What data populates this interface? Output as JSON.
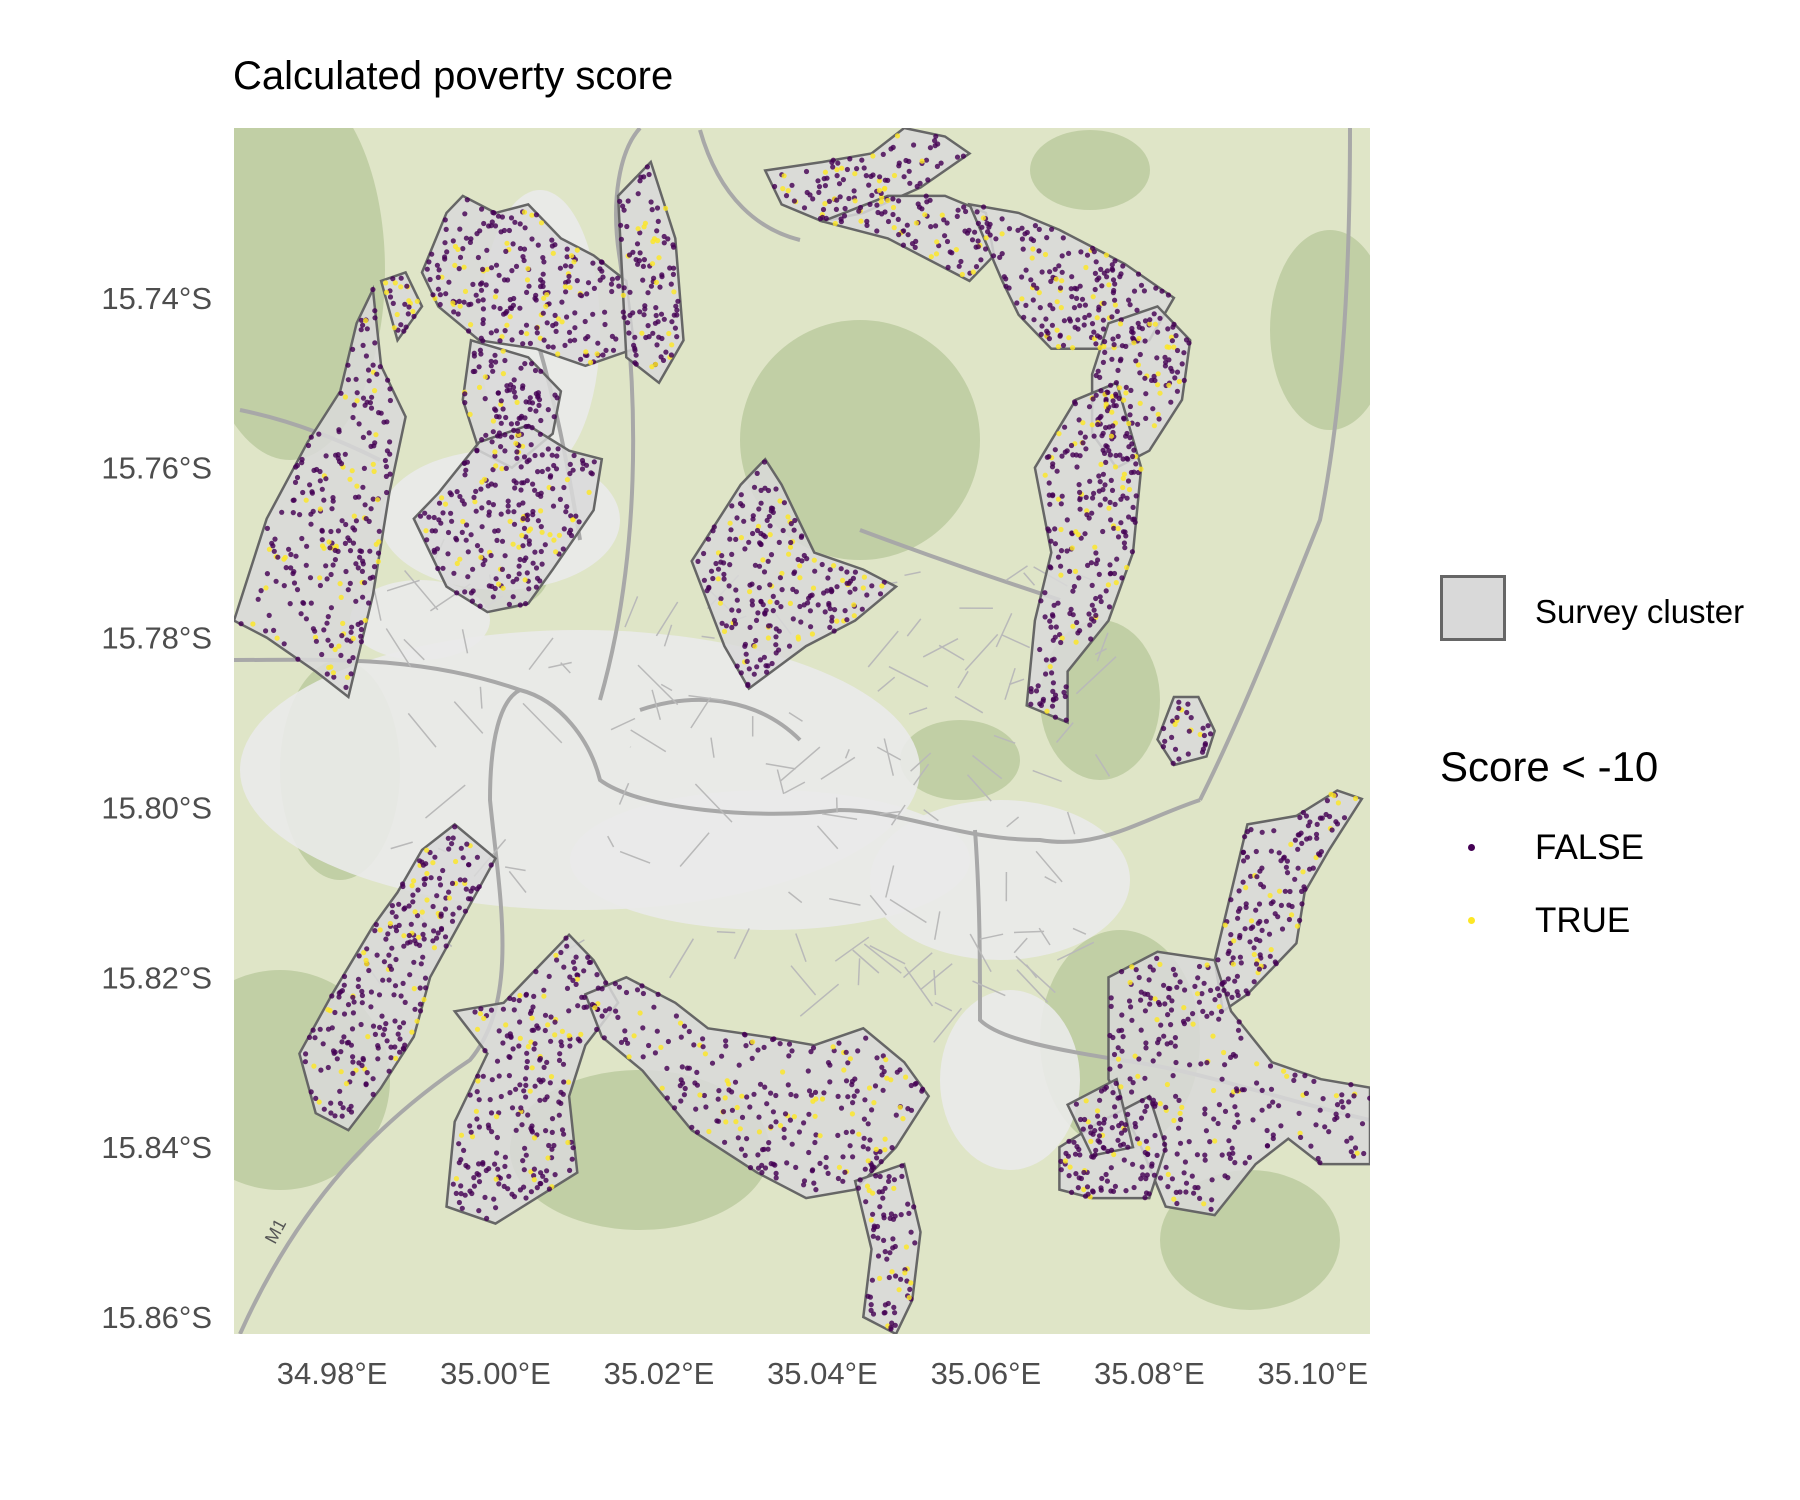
{
  "title": "Calculated poverty score",
  "map": {
    "y_axis_labels": [
      "15.74°S",
      "15.76°S",
      "15.78°S",
      "15.80°S",
      "15.82°S",
      "15.84°S",
      "15.86°S"
    ],
    "y_values": [
      -15.74,
      -15.76,
      -15.78,
      -15.8,
      -15.82,
      -15.84,
      -15.86
    ],
    "x_axis_labels": [
      "34.98°E",
      "35.00°E",
      "35.02°E",
      "35.04°E",
      "35.06°E",
      "35.08°E",
      "35.10°E"
    ],
    "x_values": [
      34.98,
      35.0,
      35.02,
      35.04,
      35.06,
      35.08,
      35.1
    ],
    "xlim": [
      34.968,
      35.107
    ],
    "ylim": [
      -15.862,
      -15.72
    ],
    "road_label": "M1",
    "basemap_colors": {
      "land": "#dfe5c7",
      "urban": "#eaeaea",
      "forest": "#b7c79a",
      "road": "#a8a8a8"
    },
    "clusters": [
      {
        "id": 1,
        "points": [
          [
            34.968,
            -15.778
          ],
          [
            34.972,
            -15.766
          ],
          [
            34.977,
            -15.757
          ],
          [
            34.981,
            -15.751
          ],
          [
            34.983,
            -15.743
          ],
          [
            34.985,
            -15.739
          ],
          [
            34.986,
            -15.748
          ],
          [
            34.989,
            -15.754
          ],
          [
            34.987,
            -15.763
          ],
          [
            34.985,
            -15.775
          ],
          [
            34.982,
            -15.787
          ],
          [
            34.978,
            -15.784
          ],
          [
            34.972,
            -15.78
          ]
        ]
      },
      {
        "id": 2,
        "points": [
          [
            34.986,
            -15.738
          ],
          [
            34.989,
            -15.737
          ],
          [
            34.991,
            -15.741
          ],
          [
            34.988,
            -15.745
          ]
        ]
      },
      {
        "id": 3,
        "points": [
          [
            34.991,
            -15.737
          ],
          [
            34.994,
            -15.73
          ],
          [
            34.996,
            -15.728
          ],
          [
            35.0,
            -15.73
          ],
          [
            35.004,
            -15.729
          ],
          [
            35.008,
            -15.733
          ],
          [
            35.012,
            -15.735
          ],
          [
            35.016,
            -15.738
          ],
          [
            35.017,
            -15.746
          ],
          [
            35.011,
            -15.748
          ],
          [
            35.005,
            -15.746
          ],
          [
            34.998,
            -15.745
          ],
          [
            34.993,
            -15.741
          ]
        ]
      },
      {
        "id": 4,
        "points": [
          [
            35.015,
            -15.728
          ],
          [
            35.019,
            -15.724
          ],
          [
            35.022,
            -15.733
          ],
          [
            35.023,
            -15.745
          ],
          [
            35.02,
            -15.75
          ],
          [
            35.016,
            -15.747
          ]
        ]
      },
      {
        "id": 5,
        "points": [
          [
            34.997,
            -15.745
          ],
          [
            35.004,
            -15.747
          ],
          [
            35.008,
            -15.751
          ],
          [
            35.007,
            -15.756
          ],
          [
            35.002,
            -15.76
          ],
          [
            34.998,
            -15.758
          ],
          [
            34.996,
            -15.752
          ]
        ]
      },
      {
        "id": 6,
        "points": [
          [
            34.99,
            -15.766
          ],
          [
            34.993,
            -15.763
          ],
          [
            34.998,
            -15.757
          ],
          [
            35.004,
            -15.755
          ],
          [
            35.009,
            -15.758
          ],
          [
            35.013,
            -15.759
          ],
          [
            35.012,
            -15.765
          ],
          [
            35.007,
            -15.772
          ],
          [
            35.004,
            -15.776
          ],
          [
            34.999,
            -15.777
          ],
          [
            34.994,
            -15.774
          ]
        ]
      },
      {
        "id": 7,
        "points": [
          [
            35.024,
            -15.771
          ],
          [
            35.028,
            -15.765
          ],
          [
            35.03,
            -15.762
          ],
          [
            35.033,
            -15.759
          ],
          [
            35.035,
            -15.762
          ],
          [
            35.037,
            -15.766
          ],
          [
            35.039,
            -15.77
          ],
          [
            35.045,
            -15.772
          ],
          [
            35.049,
            -15.774
          ],
          [
            35.044,
            -15.778
          ],
          [
            35.038,
            -15.781
          ],
          [
            35.031,
            -15.786
          ],
          [
            35.028,
            -15.781
          ],
          [
            35.026,
            -15.776
          ]
        ]
      },
      {
        "id": 8,
        "points": [
          [
            35.033,
            -15.725
          ],
          [
            35.04,
            -15.724
          ],
          [
            35.046,
            -15.723
          ],
          [
            35.05,
            -15.72
          ],
          [
            35.055,
            -15.721
          ],
          [
            35.058,
            -15.723
          ],
          [
            35.052,
            -15.727
          ],
          [
            35.045,
            -15.73
          ],
          [
            35.04,
            -15.731
          ],
          [
            35.035,
            -15.729
          ]
        ]
      },
      {
        "id": 9,
        "points": [
          [
            35.04,
            -15.731
          ],
          [
            35.048,
            -15.728
          ],
          [
            35.055,
            -15.728
          ],
          [
            35.06,
            -15.73
          ],
          [
            35.061,
            -15.735
          ],
          [
            35.058,
            -15.738
          ],
          [
            35.054,
            -15.736
          ],
          [
            35.048,
            -15.733
          ]
        ]
      },
      {
        "id": 10,
        "points": [
          [
            35.058,
            -15.729
          ],
          [
            35.064,
            -15.73
          ],
          [
            35.069,
            -15.732
          ],
          [
            35.073,
            -15.734
          ],
          [
            35.077,
            -15.736
          ],
          [
            35.08,
            -15.738
          ],
          [
            35.083,
            -15.74
          ],
          [
            35.08,
            -15.745
          ],
          [
            35.075,
            -15.746
          ],
          [
            35.068,
            -15.746
          ],
          [
            35.064,
            -15.742
          ],
          [
            35.062,
            -15.738
          ]
        ]
      },
      {
        "id": 11,
        "points": [
          [
            35.075,
            -15.743
          ],
          [
            35.081,
            -15.741
          ],
          [
            35.085,
            -15.745
          ],
          [
            35.084,
            -15.752
          ],
          [
            35.08,
            -15.758
          ],
          [
            35.076,
            -15.76
          ],
          [
            35.073,
            -15.756
          ],
          [
            35.073,
            -15.749
          ]
        ]
      },
      {
        "id": 12,
        "points": [
          [
            35.066,
            -15.76
          ],
          [
            35.071,
            -15.752
          ],
          [
            35.076,
            -15.75
          ],
          [
            35.079,
            -15.76
          ],
          [
            35.078,
            -15.77
          ],
          [
            35.075,
            -15.778
          ],
          [
            35.07,
            -15.784
          ],
          [
            35.07,
            -15.79
          ],
          [
            35.065,
            -15.788
          ],
          [
            35.066,
            -15.778
          ],
          [
            35.068,
            -15.77
          ]
        ]
      },
      {
        "id": 13,
        "points": [
          [
            35.081,
            -15.792
          ],
          [
            35.083,
            -15.787
          ],
          [
            35.086,
            -15.787
          ],
          [
            35.088,
            -15.791
          ],
          [
            35.087,
            -15.794
          ],
          [
            35.083,
            -15.795
          ]
        ]
      },
      {
        "id": 14,
        "points": [
          [
            35.092,
            -15.802
          ],
          [
            35.098,
            -15.801
          ],
          [
            35.103,
            -15.798
          ],
          [
            35.106,
            -15.799
          ],
          [
            35.102,
            -15.805
          ],
          [
            35.099,
            -15.81
          ],
          [
            35.098,
            -15.816
          ],
          [
            35.092,
            -15.822
          ],
          [
            35.089,
            -15.824
          ],
          [
            35.088,
            -15.818
          ],
          [
            35.09,
            -15.81
          ]
        ]
      },
      {
        "id": 15,
        "points": [
          [
            35.075,
            -15.82
          ],
          [
            35.081,
            -15.817
          ],
          [
            35.088,
            -15.818
          ],
          [
            35.09,
            -15.824
          ],
          [
            35.095,
            -15.83
          ],
          [
            35.101,
            -15.832
          ],
          [
            35.107,
            -15.833
          ],
          [
            35.107,
            -15.842
          ],
          [
            35.101,
            -15.842
          ],
          [
            35.097,
            -15.839
          ],
          [
            35.093,
            -15.842
          ],
          [
            35.088,
            -15.848
          ],
          [
            35.082,
            -15.847
          ],
          [
            35.079,
            -15.84
          ],
          [
            35.075,
            -15.832
          ]
        ]
      },
      {
        "id": 16,
        "points": [
          [
            35.069,
            -15.84
          ],
          [
            35.074,
            -15.837
          ],
          [
            35.08,
            -15.834
          ],
          [
            35.082,
            -15.84
          ],
          [
            35.08,
            -15.846
          ],
          [
            35.073,
            -15.846
          ],
          [
            35.069,
            -15.845
          ]
        ]
      },
      {
        "id": 17,
        "points": [
          [
            35.07,
            -15.835
          ],
          [
            35.076,
            -15.832
          ],
          [
            35.078,
            -15.84
          ],
          [
            35.073,
            -15.841
          ]
        ]
      },
      {
        "id": 18,
        "points": [
          [
            34.985,
            -15.814
          ],
          [
            34.988,
            -15.81
          ],
          [
            34.991,
            -15.805
          ],
          [
            34.995,
            -15.802
          ],
          [
            35.0,
            -15.806
          ],
          [
            34.996,
            -15.813
          ],
          [
            34.992,
            -15.82
          ],
          [
            34.99,
            -15.827
          ],
          [
            34.986,
            -15.833
          ],
          [
            34.982,
            -15.838
          ],
          [
            34.978,
            -15.836
          ],
          [
            34.976,
            -15.829
          ],
          [
            34.98,
            -15.822
          ]
        ]
      },
      {
        "id": 19,
        "points": [
          [
            34.995,
            -15.824
          ],
          [
            35.001,
            -15.823
          ],
          [
            35.005,
            -15.819
          ],
          [
            35.009,
            -15.815
          ],
          [
            35.012,
            -15.818
          ],
          [
            35.015,
            -15.823
          ],
          [
            35.011,
            -15.828
          ],
          [
            35.009,
            -15.834
          ],
          [
            35.01,
            -15.843
          ],
          [
            35.005,
            -15.846
          ],
          [
            35.0,
            -15.849
          ],
          [
            34.994,
            -15.847
          ],
          [
            34.995,
            -15.837
          ],
          [
            34.999,
            -15.829
          ]
        ]
      },
      {
        "id": 20,
        "points": [
          [
            35.011,
            -15.822
          ],
          [
            35.016,
            -15.82
          ],
          [
            35.022,
            -15.823
          ],
          [
            35.026,
            -15.826
          ],
          [
            35.033,
            -15.827
          ],
          [
            35.039,
            -15.828
          ],
          [
            35.045,
            -15.826
          ],
          [
            35.05,
            -15.83
          ],
          [
            35.053,
            -15.834
          ],
          [
            35.049,
            -15.84
          ],
          [
            35.044,
            -15.845
          ],
          [
            35.038,
            -15.846
          ],
          [
            35.032,
            -15.843
          ],
          [
            35.024,
            -15.838
          ],
          [
            35.018,
            -15.831
          ],
          [
            35.013,
            -15.827
          ]
        ]
      },
      {
        "id": 21,
        "points": [
          [
            35.044,
            -15.844
          ],
          [
            35.05,
            -15.842
          ],
          [
            35.052,
            -15.85
          ],
          [
            35.051,
            -15.858
          ],
          [
            35.049,
            -15.862
          ],
          [
            35.045,
            -15.86
          ],
          [
            35.046,
            -15.852
          ]
        ]
      }
    ]
  },
  "legend": {
    "cluster_label": "Survey cluster",
    "score_title": "Score < -10",
    "false_label": "FALSE",
    "true_label": "TRUE",
    "false_color": "#440154",
    "true_color": "#fde725",
    "cluster_fill": "#d9d9d9",
    "cluster_stroke": "#666666"
  }
}
